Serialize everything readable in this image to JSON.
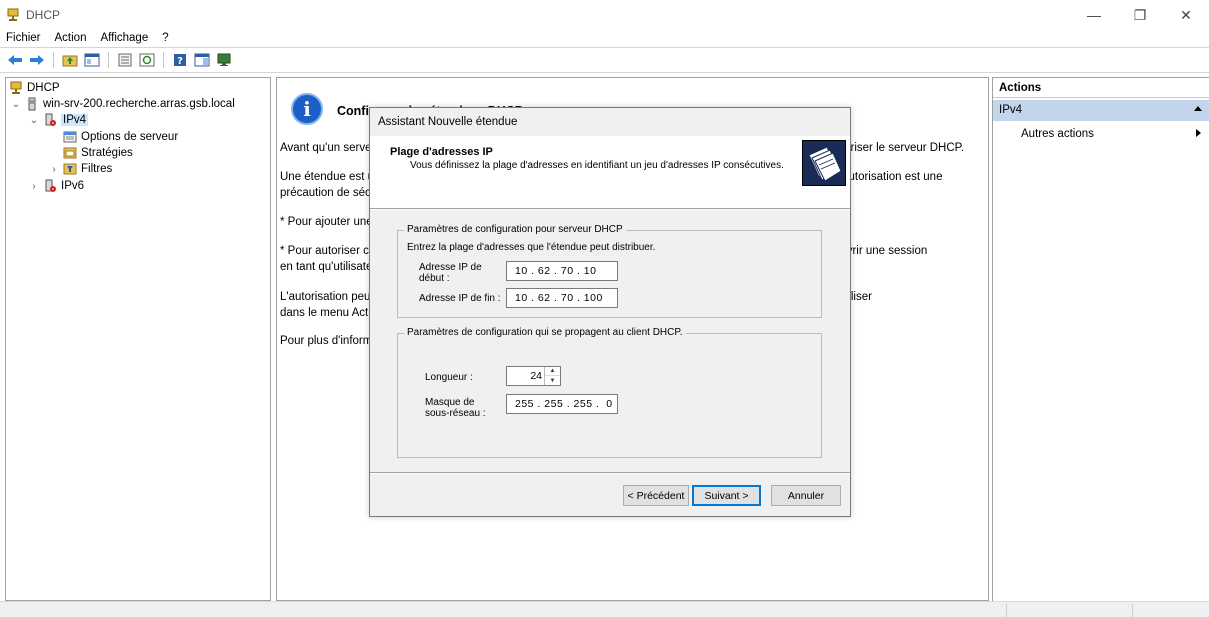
{
  "window": {
    "title": "DHCP",
    "minimize": "—",
    "maximize": "❐",
    "close": "✕"
  },
  "menu": [
    "Fichier",
    "Action",
    "Affichage",
    "?"
  ],
  "tree": {
    "root": "DHCP",
    "server": "win-srv-200.recherche.arras.gsb.local",
    "ipv4": "IPv4",
    "server_options": "Options de serveur",
    "policies": "Stratégies",
    "filters": "Filtres",
    "ipv6": "IPv6"
  },
  "center": {
    "heading": "Configurer des étendues DHCP",
    "lines": [
      "Avant qu'un serveur DHCP puisse attribuer des adresses IP aux clients, vous devez ajouter une étendue et autoriser le serveur DHCP.",
      "Une étendue est une plage d'adresses IP attribuées aux ordinateurs demandant une adresse IP dynamique. L'autorisation est une",
      "précaution de sécurité.",
      "* Pour ajouter une étendue, cliquez avec le bouton droit sur IPv4 puis cliquez sur Nouvelle étendue.",
      "* Pour autoriser ce serveur DHCP, cliquez sur Autoriser dans le menu Action. Si l'option n'est pas disponible, ouvrir une session",
      "en tant qu'utilisateur membre du groupe Administrateurs de l'entreprise.",
      "L'autorisation peut prendre un moment. Pour afficher l'état de l'autorisation, appuyez sur F5 ou cliquez sur Actualiser",
      "dans le menu Action.",
      "Pour plus d'informations sur la configuration d'un serveur DHCP, consultez l'aide en ligne."
    ]
  },
  "actions": {
    "header": "Actions",
    "section": "IPv4",
    "more": "Autres actions"
  },
  "dialog": {
    "title": "Assistant Nouvelle étendue",
    "header_title": "Plage d'adresses IP",
    "header_subtitle": "Vous définissez la plage d'adresses en identifiant un jeu d'adresses IP consécutives.",
    "group1_legend": "Paramètres de configuration pour serveur DHCP",
    "group1_intro": "Entrez la plage d'adresses que l'étendue peut distribuer.",
    "start_label_1": "Adresse IP de",
    "start_label_2": "début :",
    "start_ip": "10 . 62 . 70 . 10",
    "end_label": "Adresse IP de fin :",
    "end_ip": "10 . 62 . 70 . 100",
    "group2_legend": "Paramètres de configuration qui se propagent au client DHCP.",
    "length_label": "Longueur :",
    "length_value": "24",
    "mask_label_1": "Masque de",
    "mask_label_2": "sous-réseau :",
    "mask_value": "255 . 255 . 255 .  0",
    "btn_back": "< Précédent",
    "btn_next": "Suivant >",
    "btn_cancel": "Annuler"
  }
}
